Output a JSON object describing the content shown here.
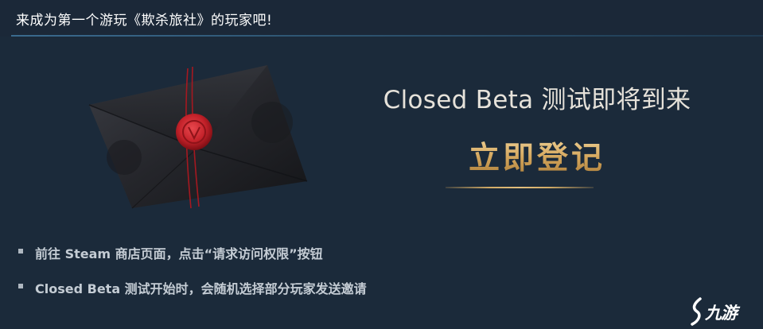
{
  "header": {
    "title": "来成为第一个游玩《欺杀旅社》的玩家吧!"
  },
  "promo": {
    "beta_title": "Closed Beta 测试即将到来",
    "register_label": "立即登记"
  },
  "bullets": [
    "前往 Steam 商店页面，点击“请求访问权限”按钮",
    "Closed Beta 测试开始时，会随机选择部分玩家发送邀请"
  ],
  "watermark": {
    "text": "九游"
  },
  "colors": {
    "background": "#1b2838",
    "gold": "#d3a55b",
    "wax_seal": "#c4222a",
    "envelope": "#2a2b2f"
  }
}
